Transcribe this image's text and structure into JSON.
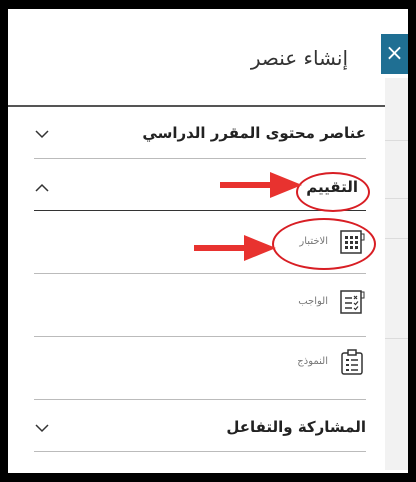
{
  "panel": {
    "title": "إنشاء عنصر",
    "close_label": "×"
  },
  "sections": {
    "course_content": {
      "label": "عناصر محتوى المقرر الدراسي"
    },
    "assessment": {
      "label": "التقييم"
    },
    "participation": {
      "label": "المشاركة والتفاعل"
    }
  },
  "items": {
    "test": {
      "label": "الاختبار"
    },
    "assignment": {
      "label": "الواجب"
    },
    "form": {
      "label": "النموذج"
    }
  },
  "colors": {
    "accent": "#1f6f93",
    "annotation_red": "#d81e24"
  },
  "icons": [
    "close-icon",
    "chevron-down-icon",
    "chevron-up-icon",
    "test-icon",
    "assignment-icon",
    "form-icon",
    "arrow-icon"
  ]
}
